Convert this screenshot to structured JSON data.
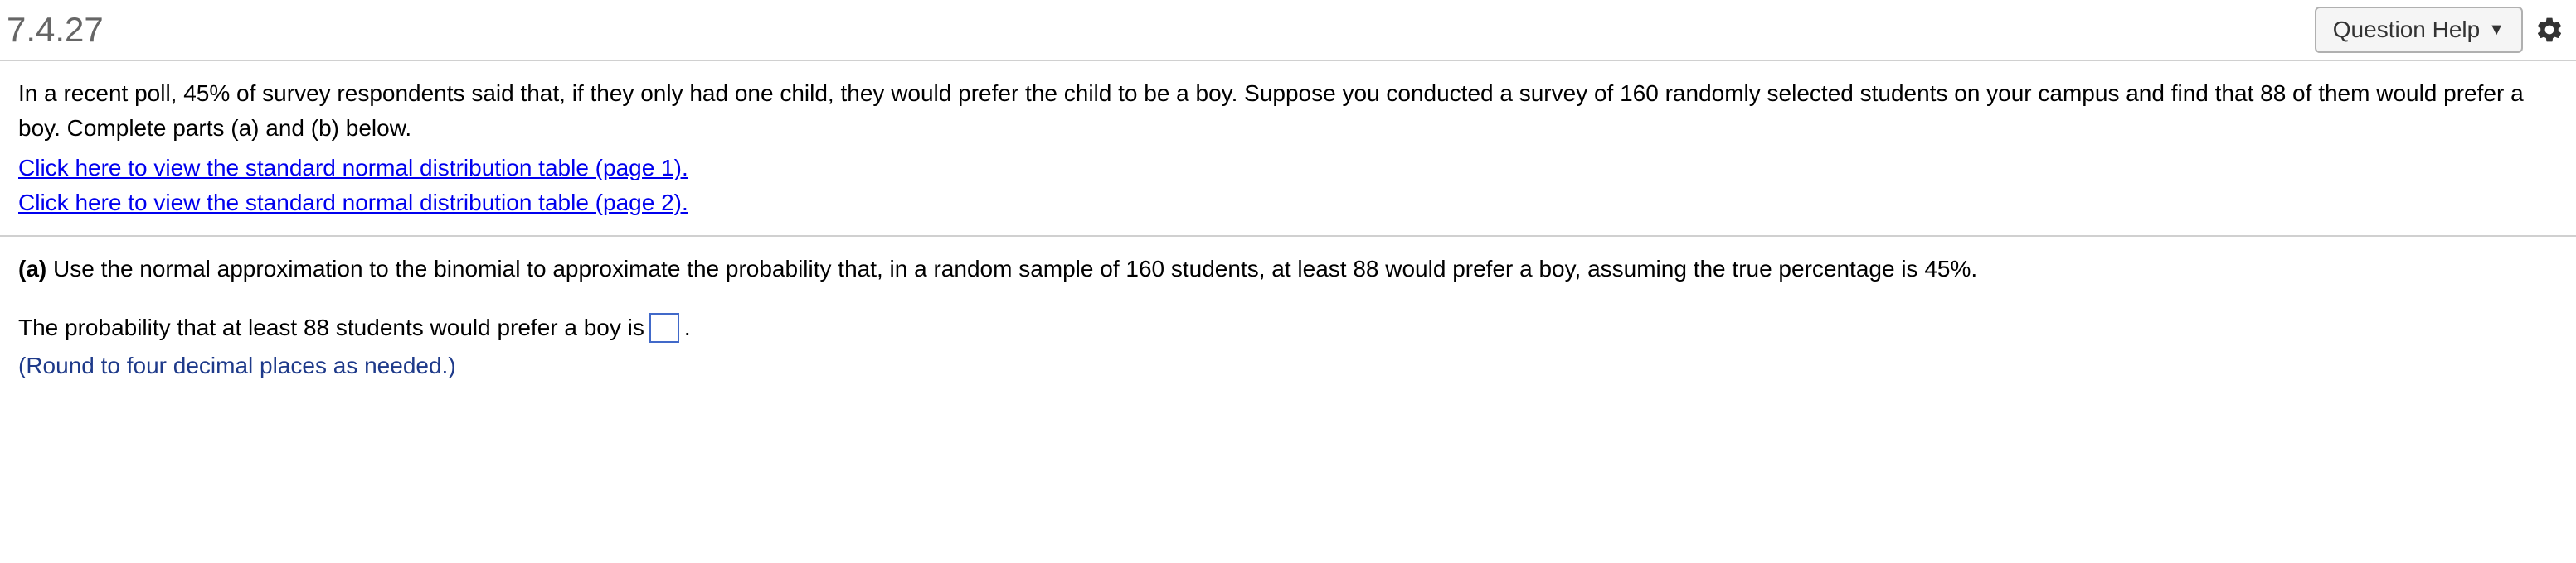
{
  "header": {
    "questionNumber": "7.4.27",
    "helpButton": "Question Help"
  },
  "intro": {
    "text": "In a recent poll, 45% of survey respondents said that, if they only had one child, they would prefer the child to be a boy. Suppose you conducted a survey of 160 randomly selected students on your campus and find that 88 of them would prefer a boy. Complete parts (a) and (b) below.",
    "link1": "Click here to view the standard normal distribution table (page 1).",
    "link2": "Click here to view the standard normal distribution table (page 2)."
  },
  "partA": {
    "label": "(a)",
    "prompt": " Use the normal approximation to the binomial to approximate the probability that, in a random sample of 160 students, at least 88 would prefer a boy, assuming the true percentage is 45%.",
    "answerPrefix": "The probability that at least 88 students would prefer a boy is ",
    "answerSuffix": ".",
    "hint": "(Round to four decimal places as needed.)"
  }
}
